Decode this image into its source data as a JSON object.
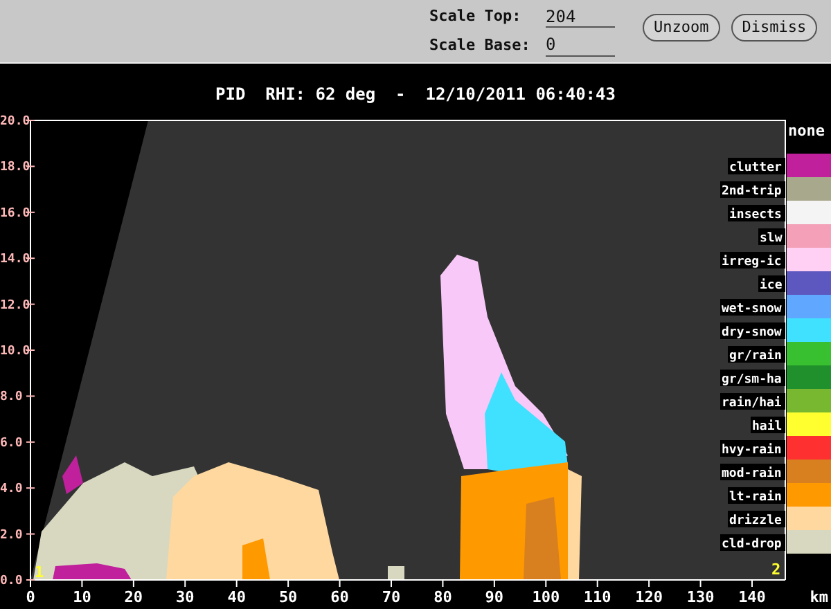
{
  "toolbar": {
    "fields": [
      {
        "label": "Scale Top:",
        "value": "204"
      },
      {
        "label": "Scale Base:",
        "value": "0"
      }
    ],
    "buttons": [
      "Unzoom",
      "Dismiss"
    ]
  },
  "plot": {
    "title": "PID  RHI: 62 deg  -  12/10/2011 06:40:43",
    "y_ticks": [
      "20.0",
      "18.0",
      "16.0",
      "14.0",
      "12.0",
      "10.0",
      "8.0",
      "6.0",
      "4.0",
      "2.0",
      "0.0"
    ],
    "x_ticks": [
      "0",
      "10",
      "20",
      "30",
      "40",
      "50",
      "60",
      "70",
      "80",
      "90",
      "100",
      "110",
      "120",
      "130",
      "140"
    ],
    "x_unit": "km",
    "markers": [
      "1",
      "2"
    ],
    "legend": {
      "header": "none",
      "entries": [
        {
          "label": "clutter",
          "color": "#c0209c"
        },
        {
          "label": "2nd-trip",
          "color": "#a8a88c"
        },
        {
          "label": "insects",
          "color": "#f4f4f4"
        },
        {
          "label": "slw",
          "color": "#f4a0b8"
        },
        {
          "label": "irreg-ic",
          "color": "#ffd0f4"
        },
        {
          "label": "ice",
          "color": "#5c58c0"
        },
        {
          "label": "wet-snow",
          "color": "#60a8ff"
        },
        {
          "label": "dry-snow",
          "color": "#40e0ff"
        },
        {
          "label": "gr/rain",
          "color": "#38c030"
        },
        {
          "label": "gr/sm-ha",
          "color": "#20902c"
        },
        {
          "label": "rain/hai",
          "color": "#78b830"
        },
        {
          "label": "hail",
          "color": "#ffff30"
        },
        {
          "label": "hvy-rain",
          "color": "#ff3030"
        },
        {
          "label": "mod-rain",
          "color": "#d88020"
        },
        {
          "label": "lt-rain",
          "color": "#ff9900"
        },
        {
          "label": "drizzle",
          "color": "#ffd8a0"
        },
        {
          "label": "cld-drop",
          "color": "#d8d8c0"
        }
      ]
    }
  }
}
